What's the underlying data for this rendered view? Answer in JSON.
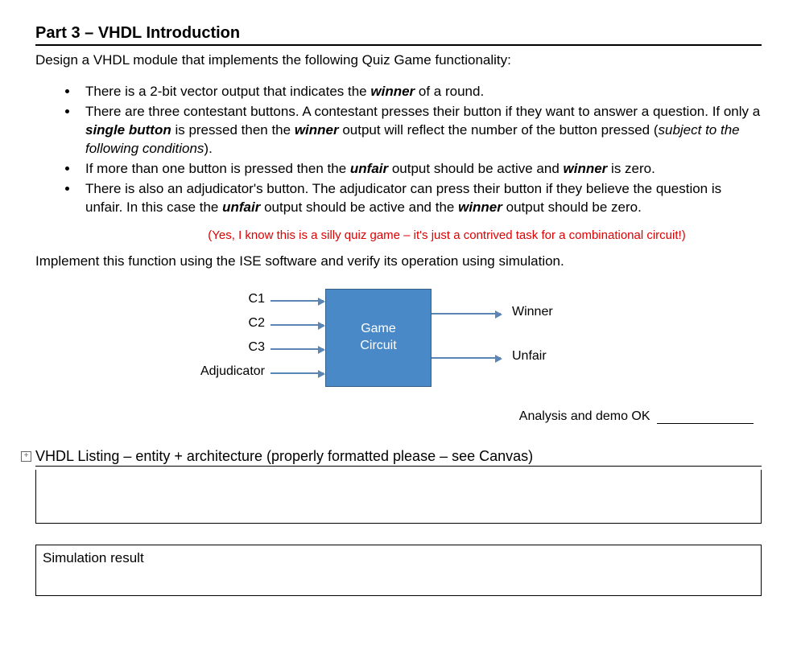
{
  "heading": "Part 3 – VHDL Introduction",
  "intro": "Design a VHDL module that implements the following Quiz Game functionality:",
  "bullets": {
    "b1_a": "There is a 2-bit vector output that indicates the ",
    "b1_w": "winner",
    "b1_b": " of a round.",
    "b2_a": "There are three contestant buttons.  A contestant presses their button if they want to answer a question.  If only a ",
    "b2_sb": "single button",
    "b2_b": " is pressed then the ",
    "b2_w": "winner",
    "b2_c": " output will reflect the number of the button pressed (",
    "b2_it": "subject to the following conditions",
    "b2_d": ").",
    "b3_a": "If more than one button is pressed then the ",
    "b3_u": "unfair",
    "b3_b": " output should be active and ",
    "b3_w": "winner",
    "b3_c": " is zero.",
    "b4_a": "There is also an adjudicator's button.  The adjudicator can press their button if they believe the question is unfair.  In this case the ",
    "b4_u": "unfair",
    "b4_b": " output should be active and the ",
    "b4_w": "winner",
    "b4_c": " output should be zero."
  },
  "red_note": "(Yes, I know this is a silly quiz game – it's just a contrived task for a combinational circuit!)",
  "instr": "Implement this function using the ISE software and verify its operation using simulation.",
  "diagram": {
    "block_l1": "Game",
    "block_l2": "Circuit",
    "in1": "C1",
    "in2": "C2",
    "in3": "C3",
    "in4": "Adjudicator",
    "out1": "Winner",
    "out2": "Unfair"
  },
  "signoff": "Analysis and demo OK",
  "section1": "VHDL Listing – entity + architecture (properly formatted please – see Canvas)",
  "section2": "Simulation result"
}
